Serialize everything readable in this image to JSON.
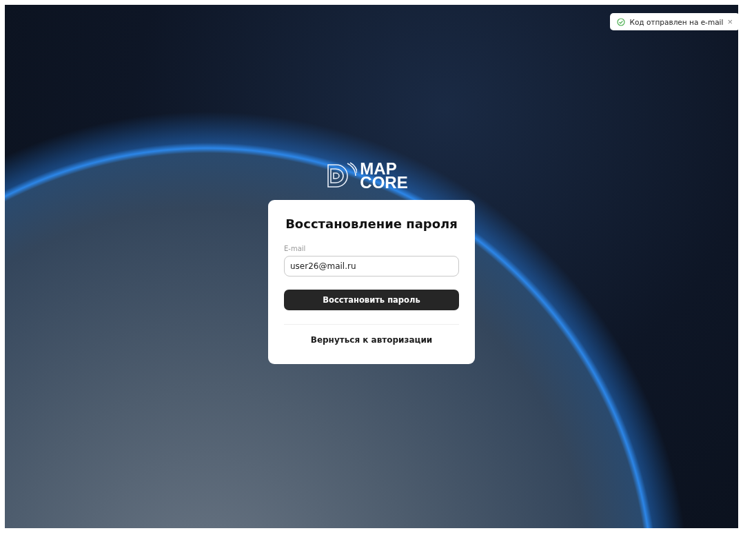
{
  "toast": {
    "message": "Код отправлен на e-mail",
    "close": "×"
  },
  "logo": {
    "line_1": "MAP",
    "line_2": "CORE"
  },
  "form": {
    "title": "Восстановление пароля",
    "email_label": "E-mail",
    "email_value": "user26@mail.ru",
    "submit": "Восстановить пароль",
    "back_link": "Вернуться к авторизации"
  }
}
